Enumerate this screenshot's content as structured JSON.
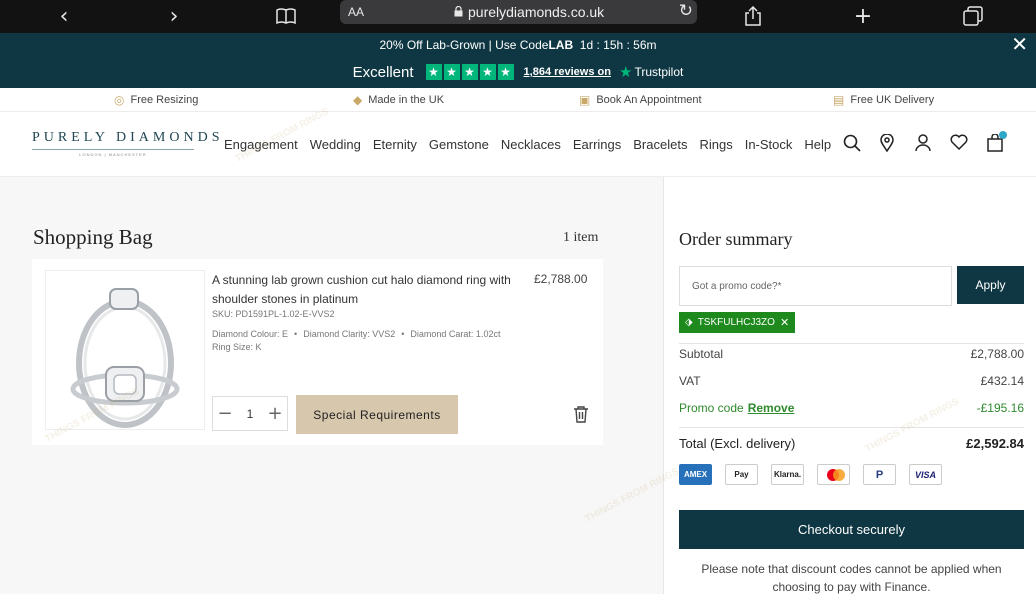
{
  "browser": {
    "text_size": "AA",
    "url": "purelydiamonds.co.uk"
  },
  "promo_banner": {
    "text_prefix": "20% Off Lab-Grown | Use Code ",
    "code": "LAB",
    "countdown": "1d : 15h : 56m"
  },
  "trustpilot": {
    "rating_label": "Excellent",
    "reviews": "1,864 reviews on",
    "brand": "Trustpilot"
  },
  "benefits": [
    {
      "label": "Free Resizing",
      "icon": "ring-icon"
    },
    {
      "label": "Made in the UK",
      "icon": "diamond-icon"
    },
    {
      "label": "Book An Appointment",
      "icon": "store-icon"
    },
    {
      "label": "Free UK Delivery",
      "icon": "delivery-icon"
    }
  ],
  "logo": {
    "name": "PURELY DIAMONDS",
    "tagline": "LONDON | MANCHESTER"
  },
  "nav": {
    "items": [
      "Engagement",
      "Wedding",
      "Eternity",
      "Gemstone",
      "Necklaces",
      "Earrings",
      "Bracelets",
      "Rings",
      "In-Stock",
      "Help"
    ]
  },
  "bag": {
    "title": "Shopping Bag",
    "count": "1 item",
    "item": {
      "name": "A stunning lab grown cushion cut halo diamond ring with shoulder stones in platinum",
      "price": "£2,788.00",
      "sku": "SKU: PD1591PL-1.02-E-VVS2",
      "colour": "Diamond Colour: E",
      "clarity": "Diamond Clarity: VVS2",
      "carat": "Diamond Carat: 1.02ct",
      "ring_size": "Ring Size: K",
      "quantity": "1",
      "special_button": "Special Requirements"
    }
  },
  "summary": {
    "title": "Order summary",
    "promo_placeholder": "Got a promo code?*",
    "apply_label": "Apply",
    "applied_code": "TSKFULHCJ3ZO",
    "subtotal_label": "Subtotal",
    "subtotal_value": "£2,788.00",
    "vat_label": "VAT",
    "vat_value": "£432.14",
    "promo_label": "Promo code",
    "remove_label": "Remove",
    "promo_value": "-£195.16",
    "total_label": "Total (Excl. delivery)",
    "total_value": "£2,592.84",
    "payments": [
      "AMEX",
      "Pay",
      "Klarna.",
      "",
      "P",
      "VISA"
    ],
    "checkout_label": "Checkout securely",
    "note": "Please note that discount codes cannot be applied when choosing to pay with Finance."
  },
  "colors": {
    "brand_dark": "#0f3743",
    "accent_gold": "#d7c7ad",
    "success_green": "#1e8a1e",
    "trustpilot_green": "#00b67a"
  }
}
